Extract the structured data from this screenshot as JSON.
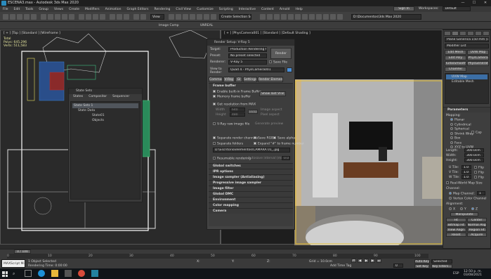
{
  "window": {
    "title": "ESCENA3.max - Autodesk 3ds Max 2020",
    "min": "—",
    "max": "☐",
    "close": "✕"
  },
  "menu": [
    "File",
    "Edit",
    "Tools",
    "Group",
    "Views",
    "Create",
    "Modifiers",
    "Animation",
    "Graph Editors",
    "Rendering",
    "Civil View",
    "Customize",
    "Scripting",
    "Interactive",
    "Content",
    "Arnold",
    "Help"
  ],
  "toolbar": {
    "selection_set": "Create Selection Se",
    "path": "D:\\Documentos\\3ds Max 2020",
    "sign_in": "Sign In",
    "workspaces_label": "Workspaces:",
    "workspace": "Default",
    "view_dropdown": "View",
    "image_comp": "Image Comp",
    "unreal": "UNREAL"
  },
  "left_viewport": {
    "label": "[ + ] [Top ] [Standard ] [Wireframe ]",
    "stats": [
      "Total",
      "Polys: 645,296",
      "Verts: 511,583"
    ]
  },
  "state_sets": {
    "title": "State Sets",
    "menus": [
      "States",
      "Compositor",
      "Sequencer"
    ],
    "root": "State Sets 1",
    "items": [
      "State Data",
      "State01",
      "Objects"
    ]
  },
  "right_viewport": {
    "label": "[ + ] [PhysCamera001 ] [Standard ] [Default Shading ]"
  },
  "render_setup": {
    "title": "Render Setup: V-Ray 5",
    "target_label": "Target:",
    "target": "Production Rendering Mode",
    "preset_label": "Preset:",
    "preset": "No preset selected",
    "renderer_label": "Renderer:",
    "renderer": "V-Ray 5",
    "save_file": "Save File",
    "render_button": "Render",
    "view_label": "View to Render:",
    "view": "Quad 4 - PhysCamera001",
    "tabs": [
      "Common",
      "V-Ray",
      "GI",
      "Settings",
      "Render Elements"
    ],
    "frame_buffer_header": "Frame buffer",
    "enable_fb": "Enable built-in Frame Buffer",
    "memory_fb": "Memory frame buffer",
    "show_last_vfb": "Show last VFB",
    "get_res": "Get resolution from MAX",
    "width_label": "Width",
    "width": "640",
    "height_label": "Height",
    "height": "480",
    "swap": "Swap",
    "image_aspect": "Image aspect",
    "pixel_aspect": "Pixel aspect",
    "raw_label": "V-Ray raw image file",
    "gen_preview": "Generate preview",
    "separate_channels": "Separate render channels",
    "save_rgb": "Save RGB",
    "save_alpha": "Save alpha",
    "separate_folders": "Separate folders",
    "expand": "Expand \"#\" to frame number",
    "channels_path": "D:\\Escritorio\\elementos\\CAMARA 01_.jpg",
    "resumable": "Resumable rendering",
    "autosave": "Autosave interval (min)",
    "autosave_value": "0.0",
    "rollouts": [
      "Global switches",
      "IPR options",
      "Image sampler (Antialiasing)",
      "Progressive image sampler",
      "Image filter",
      "Global DMC",
      "Environment",
      "Color mapping",
      "Camera"
    ]
  },
  "command_panel": {
    "object_name": "Plane Generica 150 mm (16:10)",
    "modifier_list": "Modifier List",
    "buttons": [
      "Edit Mesh",
      "UVW Map",
      "Edit Poly",
      "PhysCamera",
      "TurboSmooth",
      "PhysGenerator",
      "Chamfer"
    ],
    "stack": [
      "UVW Map",
      "Editable Mesh"
    ],
    "parameters_header": "Parameters",
    "mapping_label": "Mapping:",
    "mapping_options": [
      "Planar",
      "Cylindrical",
      "Spherical",
      "Shrink Wrap",
      "Box",
      "Face",
      "XYZ to UVW"
    ],
    "cap_label": "Cap",
    "length_label": "Length:",
    "length": "300.0cm",
    "width_label": "Width:",
    "width": "300.0cm",
    "height_label": "Height:",
    "height": "300.0cm",
    "tile_labels": [
      "U Tile:",
      "V Tile:",
      "W Tile:"
    ],
    "tile_values": [
      "1.0",
      "1.0",
      "1.0"
    ],
    "flip": "Flip",
    "real_world": "Real-World Map Size",
    "channel_label": "Channel:",
    "map_channel": "Map Channel:",
    "map_channel_value": "1",
    "vertex_color": "Vertex Color Channel",
    "alignment": "Alignment:",
    "axes": [
      "X",
      "Y",
      "Z"
    ],
    "manipulate": "Manipulate",
    "align_buttons": [
      "Fit",
      "Center",
      "Bitmap Fit",
      "Normal Align",
      "View Align",
      "Region Fit",
      "Reset",
      "Acquire"
    ]
  },
  "timeline": {
    "frame": "0 / 100",
    "ticks": [
      "0",
      "10",
      "20",
      "30",
      "40",
      "50",
      "60",
      "70",
      "80",
      "90",
      "100"
    ]
  },
  "status": {
    "maxscript": "MAXScript Mi",
    "selected": "1 Object Selected",
    "render_time": "Rendering Time: 0:00:00",
    "x_label": "X:",
    "y_label": "Y:",
    "z_label": "Z:",
    "grid": "Grid = 10.0cm",
    "add_time_tag": "Add Time Tag",
    "auto_key": "Auto Key",
    "set_key": "Set Key",
    "selected_dropdown": "Selected",
    "key_filters": "Key Filters...",
    "frame_value": "0"
  },
  "taskbar": {
    "search": "Search",
    "time": "12:50 p. m.",
    "date": "03/08/2021",
    "lang": "ESP"
  },
  "colors": {
    "accent": "#4a90d9",
    "wall": "#bcbcbc",
    "wood": "#6a3d22",
    "tv": "#111111"
  }
}
